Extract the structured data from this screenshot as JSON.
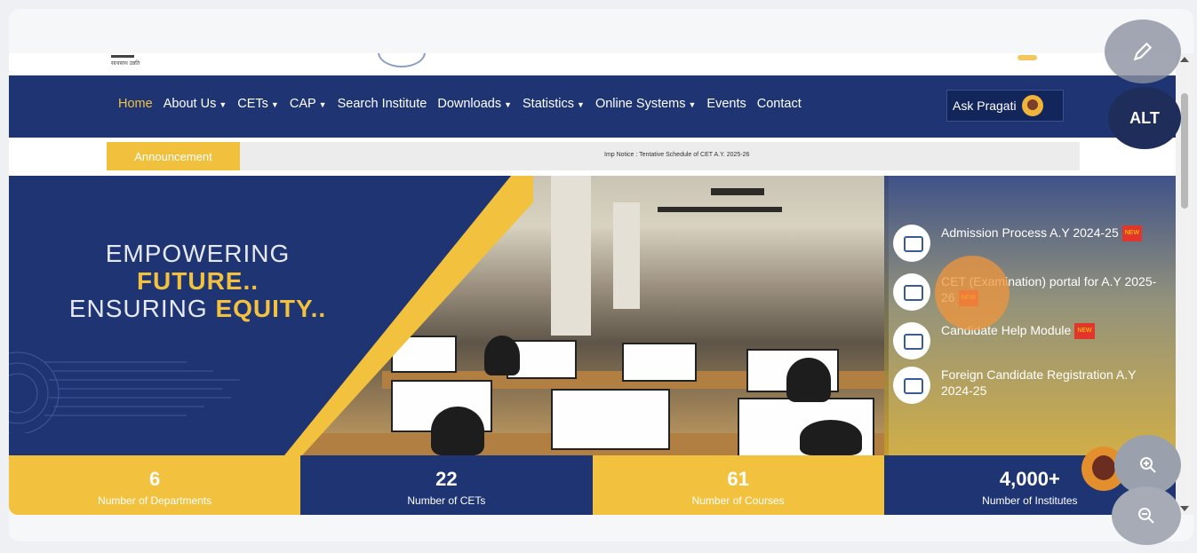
{
  "header": {
    "logo_left_text": "साथसाथ उन्नति"
  },
  "nav": {
    "items": [
      {
        "label": "Home",
        "caret": false,
        "active": true
      },
      {
        "label": "About Us",
        "caret": true
      },
      {
        "label": "CETs",
        "caret": true
      },
      {
        "label": "CAP",
        "caret": true
      },
      {
        "label": "Search Institute",
        "caret": false
      },
      {
        "label": "Downloads",
        "caret": true
      },
      {
        "label": "Statistics",
        "caret": true
      },
      {
        "label": "Online Systems",
        "caret": true
      },
      {
        "label": "Events",
        "caret": false
      },
      {
        "label": "Contact",
        "caret": false
      }
    ],
    "ask_button": "Ask Pragati"
  },
  "announcement": {
    "tab": "Announcement",
    "marquee": "Imp Notice : Tentative Schedule of CET A.Y. 2025-26"
  },
  "hero": {
    "line1": "EMPOWERING",
    "line2": "FUTURE..",
    "line3a": "ENSURING ",
    "line3b": "EQUITY.."
  },
  "quick_links": [
    {
      "label": "Admission Process A.Y 2024-25",
      "badge": "NEW"
    },
    {
      "label": "CET (Examination) portal for A.Y 2025-26",
      "badge": "NEW"
    },
    {
      "label": "Candidate Help Module",
      "badge": "NEW"
    },
    {
      "label": "Foreign Candidate Registration A.Y 2024-25",
      "badge": ""
    }
  ],
  "stats": [
    {
      "value": "6",
      "label": "Number of Departments",
      "style": "yellow"
    },
    {
      "value": "22",
      "label": "Number of CETs",
      "style": "blue"
    },
    {
      "value": "61",
      "label": "Number of Courses",
      "style": "yellow"
    },
    {
      "value": "4,000+",
      "label": "Number of Institutes",
      "style": "blue"
    }
  ],
  "floating": {
    "edit_icon": "pencil-icon",
    "alt_label": "ALT",
    "zoom_in_icon": "zoom-in-icon",
    "zoom_out_icon": "zoom-out-icon"
  },
  "colors": {
    "navy": "#1e3473",
    "gold": "#f2c13d",
    "nav_active": "#f1c440"
  }
}
